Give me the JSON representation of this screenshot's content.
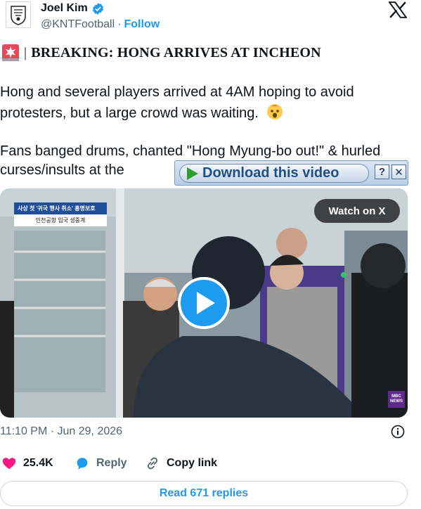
{
  "author": {
    "display_name": "Joel Kim",
    "handle": "@KNTFootball",
    "separator": "·",
    "follow_label": "Follow"
  },
  "tweet": {
    "headline": "BREAKING: HONG ARRIVES AT INCHEON",
    "headline_separator": "|",
    "paragraph_1": "Hong and several players arrived at 4AM hoping to avoid protesters, but a large crowd was waiting.",
    "paragraph_2": "Fans banged drums, chanted \"Hong Myung-bo out!\" & hurled curses/insults at the"
  },
  "download_bar": {
    "label": "Download this video",
    "help_label": "?",
    "close_label": "✕"
  },
  "video": {
    "caption_top": "사상 첫 '귀국 행사 취소' 홍명보호",
    "caption_bottom": "인천공항 입국 생중계",
    "watch_label": "Watch on X",
    "network_badge": "MBC NEWS"
  },
  "meta": {
    "timestamp": "11:10 PM · Jun 29, 2026"
  },
  "actions": {
    "like_count": "25.4K",
    "reply_label": "Reply",
    "copy_link_label": "Copy link"
  },
  "footer": {
    "read_replies_label": "Read 671 replies"
  },
  "colors": {
    "accent": "#1d9bf0",
    "text": "#0f1419",
    "muted": "#536471",
    "like": "#f91880"
  },
  "icons": [
    "avatar-emblem",
    "verified-badge-icon",
    "x-logo-icon",
    "siren-icon",
    "shocked-face-icon",
    "play-icon",
    "info-icon",
    "heart-icon",
    "reply-bubble-icon",
    "link-icon"
  ]
}
